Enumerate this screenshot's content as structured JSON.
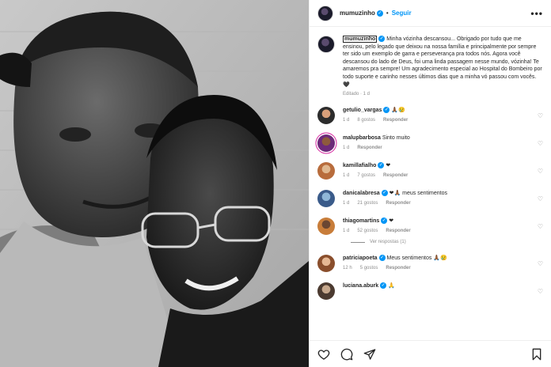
{
  "post": {
    "author": "mumuzinho",
    "follow_label": "Seguir",
    "separator": "•",
    "more_label": "•••",
    "caption": "Minha vózinha descansou... Obrigado por tudo que me ensinou, pelo legado que deixou na nossa família e principalmente por sempre ter sido um exemplo de garra e perseverança pra todos nós. Agora você descansou do lado de Deus, foi uma linda passagem nesse mundo, vózinha! Te amaremos pra sempre! Um agradecimento especial ao Hospital do Bombeiro por todo suporte e carinho nesses últimos dias que a minha vó passou com vocês. 🖤",
    "meta": "Editado · 1 d"
  },
  "comments": [
    {
      "user": "getulio_vargas",
      "verified": true,
      "text": "🙏🏾😢",
      "time": "1 d",
      "likes": "8 gostos",
      "reply": "Responder",
      "avatar_class": "av-1",
      "story": false
    },
    {
      "user": "malupbarbosa",
      "verified": false,
      "text": "Sinto muito",
      "time": "1 d",
      "likes": "",
      "reply": "Responder",
      "avatar_class": "av-2",
      "story": true
    },
    {
      "user": "kamillafialho",
      "verified": true,
      "text": "❤",
      "time": "1 d",
      "likes": "7 gostos",
      "reply": "Responder",
      "avatar_class": "av-3",
      "story": false
    },
    {
      "user": "danicalabresa",
      "verified": true,
      "text": "❤🙏🏾 meus sentimentos",
      "time": "1 d",
      "likes": "21 gostos",
      "reply": "Responder",
      "avatar_class": "av-4",
      "story": false
    },
    {
      "user": "thiagomartins",
      "verified": true,
      "text": "❤",
      "time": "1 d",
      "likes": "52 gostos",
      "reply": "Responder",
      "avatar_class": "av-5",
      "story": false
    },
    {
      "user": "patriciapoeta",
      "verified": true,
      "text": "Meus sentimentos 🙏🏾😢",
      "time": "12 h",
      "likes": "5 gostos",
      "reply": "Responder",
      "avatar_class": "av-6",
      "story": false
    },
    {
      "user": "luciana.aburk",
      "verified": true,
      "text": "🙏",
      "time": "",
      "likes": "",
      "reply": "",
      "avatar_class": "av-7",
      "story": false
    }
  ],
  "view_replies": "Ver respostas (1)",
  "actions": {
    "like_icon": "heart-icon",
    "comment_icon": "comment-icon",
    "share_icon": "share-icon",
    "save_icon": "bookmark-icon"
  },
  "colors": {
    "accent": "#0095f6",
    "like": "#ed4956",
    "muted": "#8e8e8e"
  }
}
